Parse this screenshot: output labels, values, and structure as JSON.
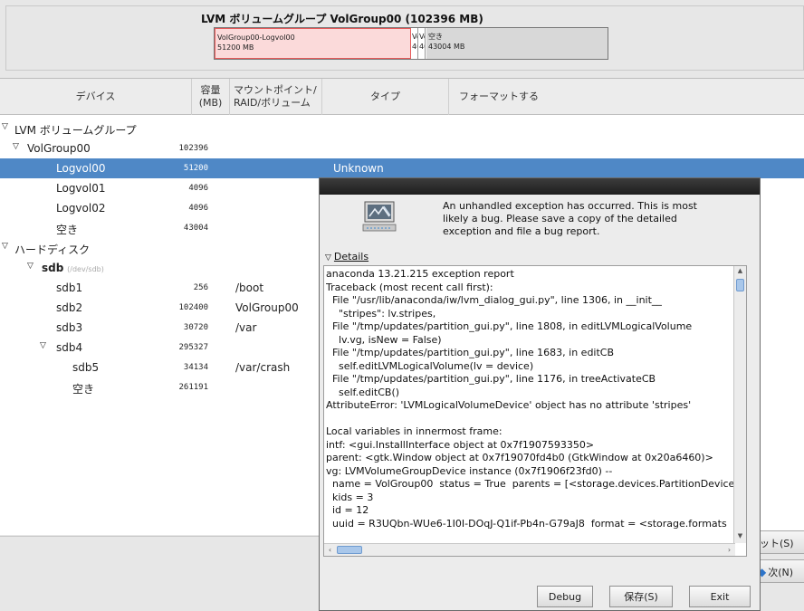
{
  "volume_group": {
    "title": "LVM ボリュームグループ  VolGroup00 (102396 MB)",
    "segments": [
      {
        "name": "VolGroup00-Logvol00",
        "size": "51200 MB"
      },
      {
        "name": "Vol",
        "size": "409"
      },
      {
        "name": "Vol",
        "size": "409"
      },
      {
        "name": "空き",
        "size": "43004 MB"
      }
    ]
  },
  "table": {
    "headers": {
      "device": "デバイス",
      "capacity": "容量 (MB)",
      "mount": "マウントポイント/ RAID/ボリューム",
      "type": "タイプ",
      "format": "フォーマットする"
    },
    "rows": [
      {
        "device": "LVM ボリュームグループ",
        "capacity": "",
        "mount": "",
        "type": ""
      },
      {
        "device": "VolGroup00",
        "capacity": "102396",
        "mount": "",
        "type": ""
      },
      {
        "device": "Logvol00",
        "capacity": "51200",
        "mount": "",
        "type": "Unknown"
      },
      {
        "device": "Logvol01",
        "capacity": "4096",
        "mount": "",
        "type": ""
      },
      {
        "device": "Logvol02",
        "capacity": "4096",
        "mount": "",
        "type": ""
      },
      {
        "device": "空き",
        "capacity": "43004",
        "mount": "",
        "type": ""
      },
      {
        "device": "ハードディスク",
        "capacity": "",
        "mount": "",
        "type": ""
      },
      {
        "device": "sdb",
        "device_sub": "(/dev/sdb)",
        "capacity": "",
        "mount": "",
        "type": ""
      },
      {
        "device": "sdb1",
        "capacity": "256",
        "mount": "/boot",
        "type": ""
      },
      {
        "device": "sdb2",
        "capacity": "102400",
        "mount": "VolGroup00",
        "type": ""
      },
      {
        "device": "sdb3",
        "capacity": "30720",
        "mount": "/var",
        "type": ""
      },
      {
        "device": "sdb4",
        "capacity": "295327",
        "mount": "",
        "type": ""
      },
      {
        "device": "sdb5",
        "capacity": "34134",
        "mount": "/var/crash",
        "type": ""
      },
      {
        "device": "空き",
        "capacity": "261191",
        "mount": "",
        "type": ""
      }
    ]
  },
  "buttons": {
    "reset": "ット(S)",
    "next": "次(N)"
  },
  "dialog": {
    "message": "An unhandled exception has occurred.  This is most likely a bug.  Please save a copy of the detailed exception and file a bug report.",
    "details_label": "Details",
    "details_text": "anaconda 13.21.215 exception report\nTraceback (most recent call first):\n  File \"/usr/lib/anaconda/iw/lvm_dialog_gui.py\", line 1306, in __init__\n    \"stripes\": lv.stripes,\n  File \"/tmp/updates/partition_gui.py\", line 1808, in editLVMLogicalVolume\n    lv.vg, isNew = False)\n  File \"/tmp/updates/partition_gui.py\", line 1683, in editCB\n    self.editLVMLogicalVolume(lv = device)\n  File \"/tmp/updates/partition_gui.py\", line 1176, in treeActivateCB\n    self.editCB()\nAttributeError: 'LVMLogicalVolumeDevice' object has no attribute 'stripes'\n\nLocal variables in innermost frame:\nintf: <gui.InstallInterface object at 0x7f1907593350>\nparent: <gtk.Window object at 0x7f19070fd4b0 (GtkWindow at 0x20a6460)>\nvg: LVMVolumeGroupDevice instance (0x7f1906f23fd0) --\n  name = VolGroup00  status = True  parents = [<storage.devices.PartitionDevice\n  kids = 3\n  id = 12\n  uuid = R3UQbn-WUe6-1I0I-DOqJ-Q1if-Pb4n-G79aJ8  format = <storage.formats",
    "debug_button": "Debug",
    "save_button": "保存(S)",
    "exit_button": "Exit"
  }
}
